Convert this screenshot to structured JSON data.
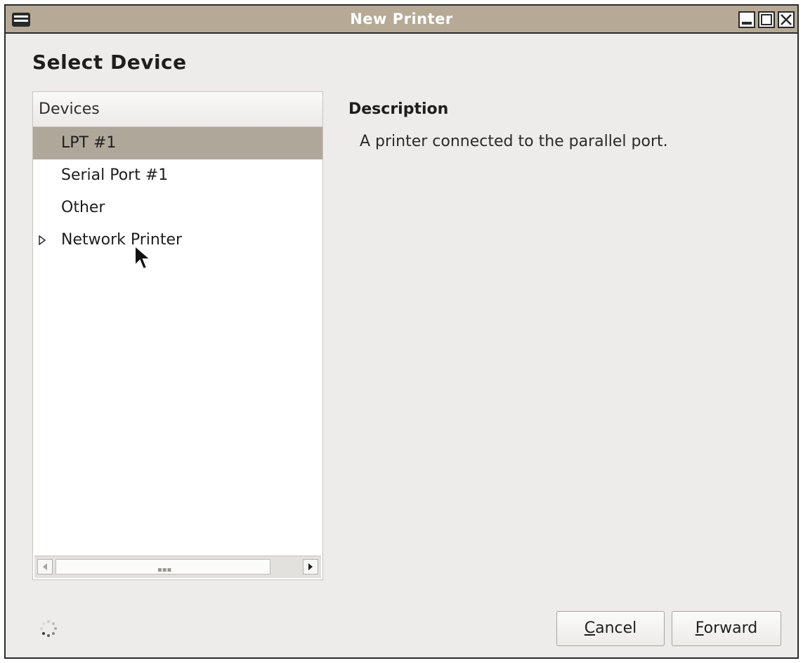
{
  "window": {
    "title": "New Printer",
    "titlebar_color": "#b6aa97",
    "icon": "printer-icon",
    "controls": [
      "minimize-icon",
      "maximize-icon",
      "close-icon"
    ]
  },
  "page": {
    "heading": "Select Device"
  },
  "devices": {
    "header": "Devices",
    "items": [
      {
        "label": "LPT #1",
        "selected": true
      },
      {
        "label": "Serial Port #1",
        "selected": false
      },
      {
        "label": "Other",
        "selected": false
      },
      {
        "label": "Network Printer",
        "selected": false,
        "expandable": true
      }
    ],
    "selection_color": "#afa79a"
  },
  "description": {
    "title": "Description",
    "text": "A printer connected to the parallel port."
  },
  "buttons": {
    "cancel_mnemonic": "C",
    "cancel_rest": "ancel",
    "forward_mnemonic": "F",
    "forward_rest": "orward"
  },
  "status": {
    "spinner_icon": "spinner-icon"
  }
}
